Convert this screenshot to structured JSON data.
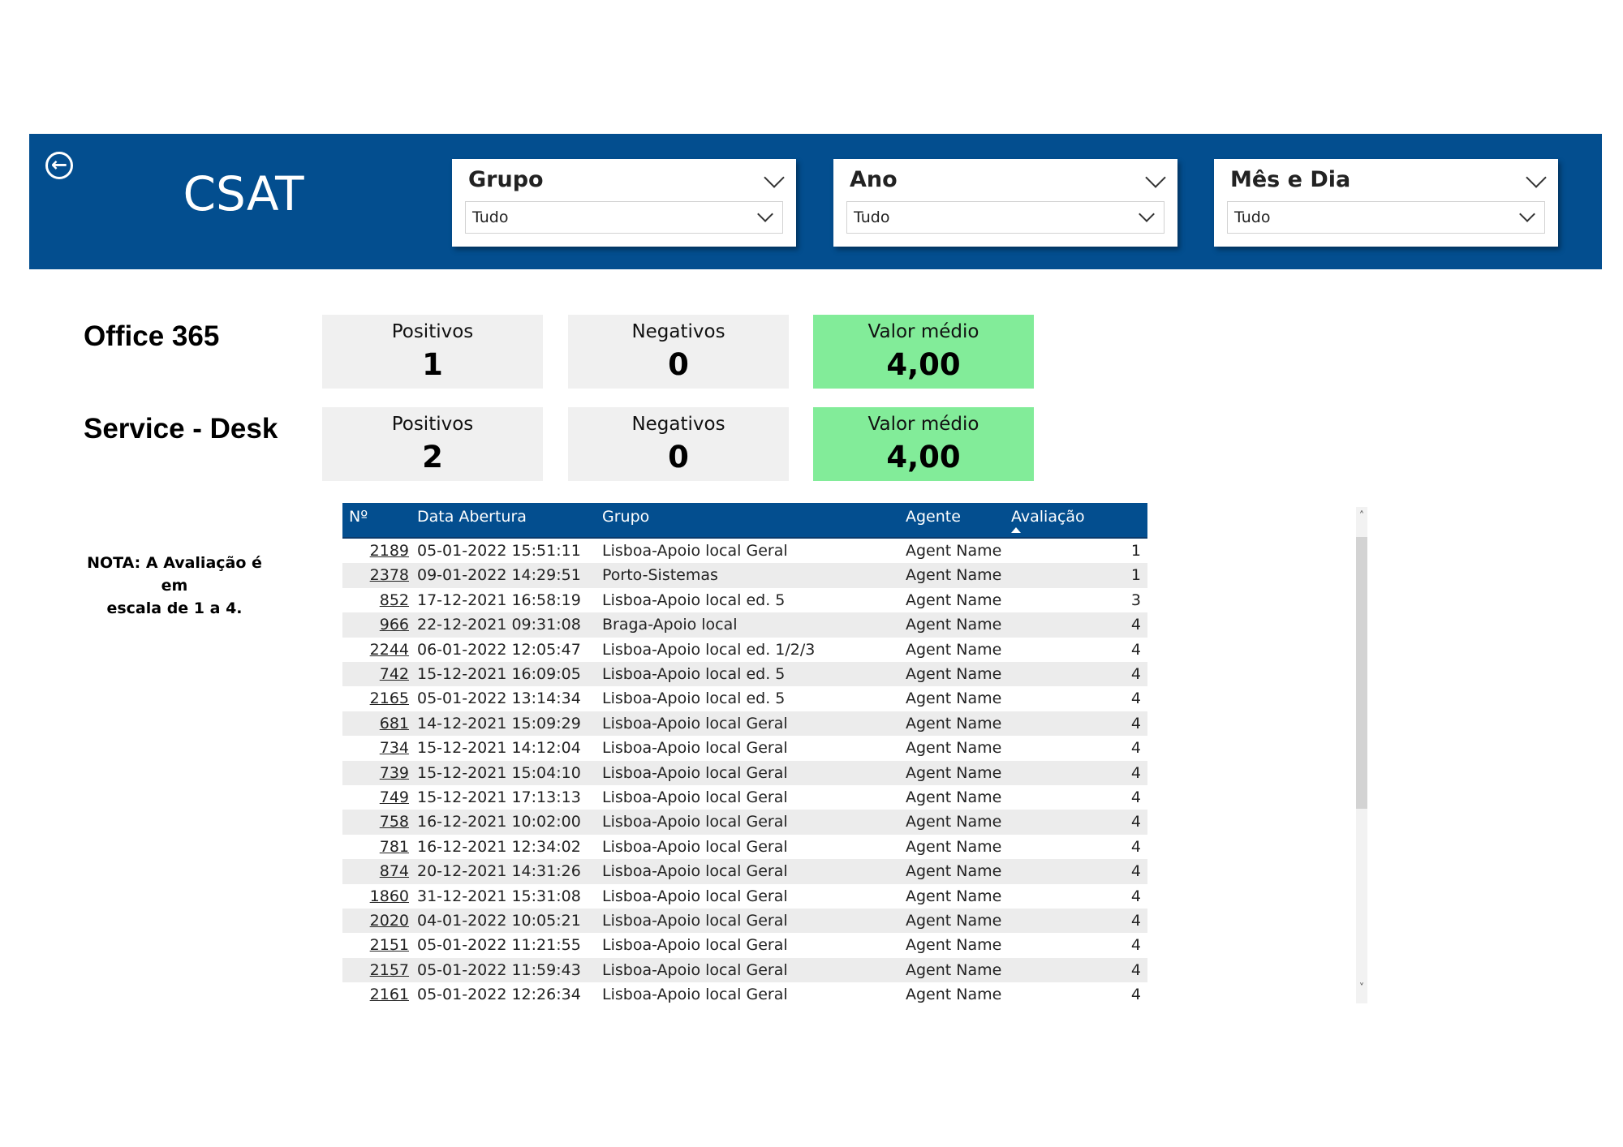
{
  "header": {
    "title": "CSAT",
    "back_icon": "arrow-left-circle-icon",
    "background": "#034e8f"
  },
  "slicers": [
    {
      "title": "Grupo",
      "value": "Tudo"
    },
    {
      "title": "Ano",
      "value": "Tudo"
    },
    {
      "title": "Mês e Dia",
      "value": "Tudo"
    }
  ],
  "sections": [
    {
      "label": "Office 365",
      "kpis": [
        {
          "label": "Positivos",
          "value": "1"
        },
        {
          "label": "Negativos",
          "value": "0"
        },
        {
          "label": "Valor médio",
          "value": "4,00"
        }
      ]
    },
    {
      "label": "Service - Desk",
      "kpis": [
        {
          "label": "Positivos",
          "value": "2"
        },
        {
          "label": "Negativos",
          "value": "0"
        },
        {
          "label": "Valor médio",
          "value": "4,00"
        }
      ]
    }
  ],
  "note": {
    "line1": "NOTA: A Avaliação é em",
    "line2": "escala de 1 a 4."
  },
  "table": {
    "columns": [
      "Nº",
      "Data Abertura",
      "Grupo",
      "Agente",
      "Avaliação"
    ],
    "sort_column": "Avaliação",
    "sort_direction": "ascending",
    "rows": [
      [
        "2189",
        "05-01-2022 15:51:11",
        "Lisboa-Apoio local Geral",
        "Agent Name",
        "1"
      ],
      [
        "2378",
        "09-01-2022 14:29:51",
        "Porto-Sistemas",
        "Agent Name",
        "1"
      ],
      [
        "852",
        "17-12-2021 16:58:19",
        "Lisboa-Apoio local ed. 5",
        "Agent Name",
        "3"
      ],
      [
        "966",
        "22-12-2021 09:31:08",
        "Braga-Apoio local",
        "Agent Name",
        "4"
      ],
      [
        "2244",
        "06-01-2022 12:05:47",
        "Lisboa-Apoio local ed. 1/2/3",
        "Agent Name",
        "4"
      ],
      [
        "742",
        "15-12-2021 16:09:05",
        "Lisboa-Apoio local ed. 5",
        "Agent Name",
        "4"
      ],
      [
        "2165",
        "05-01-2022 13:14:34",
        "Lisboa-Apoio local ed. 5",
        "Agent Name",
        "4"
      ],
      [
        "681",
        "14-12-2021 15:09:29",
        "Lisboa-Apoio local Geral",
        "Agent Name",
        "4"
      ],
      [
        "734",
        "15-12-2021 14:12:04",
        "Lisboa-Apoio local Geral",
        "Agent Name",
        "4"
      ],
      [
        "739",
        "15-12-2021 15:04:10",
        "Lisboa-Apoio local Geral",
        "Agent Name",
        "4"
      ],
      [
        "749",
        "15-12-2021 17:13:13",
        "Lisboa-Apoio local Geral",
        "Agent Name",
        "4"
      ],
      [
        "758",
        "16-12-2021 10:02:00",
        "Lisboa-Apoio local Geral",
        "Agent Name",
        "4"
      ],
      [
        "781",
        "16-12-2021 12:34:02",
        "Lisboa-Apoio local Geral",
        "Agent Name",
        "4"
      ],
      [
        "874",
        "20-12-2021 14:31:26",
        "Lisboa-Apoio local Geral",
        "Agent Name",
        "4"
      ],
      [
        "1860",
        "31-12-2021 15:31:08",
        "Lisboa-Apoio local Geral",
        "Agent Name",
        "4"
      ],
      [
        "2020",
        "04-01-2022 10:05:21",
        "Lisboa-Apoio local Geral",
        "Agent Name",
        "4"
      ],
      [
        "2151",
        "05-01-2022 11:21:55",
        "Lisboa-Apoio local Geral",
        "Agent Name",
        "4"
      ],
      [
        "2157",
        "05-01-2022 11:59:43",
        "Lisboa-Apoio local Geral",
        "Agent Name",
        "4"
      ],
      [
        "2161",
        "05-01-2022 12:26:34",
        "Lisboa-Apoio local Geral",
        "Agent Name",
        "4"
      ]
    ]
  },
  "colors": {
    "header_blue": "#034e8f",
    "kpi_grey": "#f0f0f0",
    "kpi_green": "#82ec99",
    "row_alt": "#ececec"
  }
}
